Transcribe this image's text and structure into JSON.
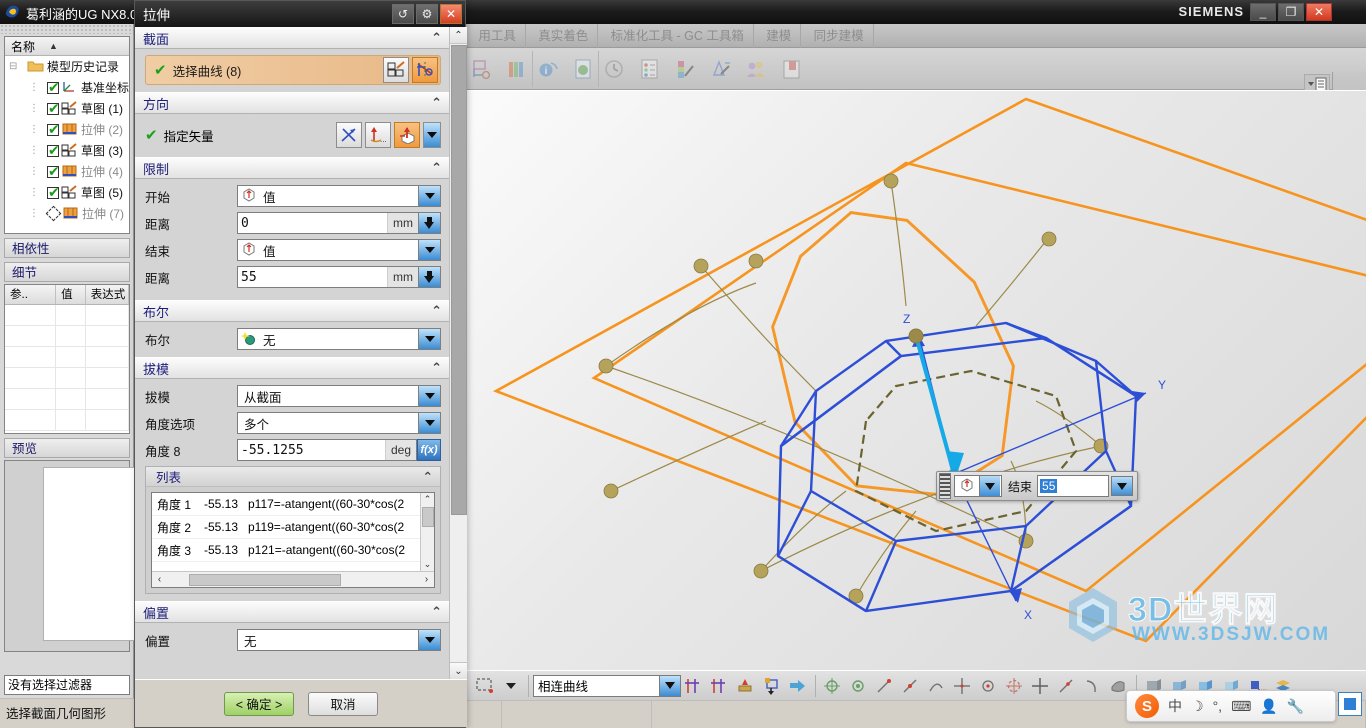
{
  "app": {
    "title": "葛利涵的UG NX8.0",
    "vendor": "SIEMENS",
    "window_buttons": {
      "minimize": "_",
      "maximize": "❐",
      "close": "✕"
    }
  },
  "ribbon": {
    "tabs": [
      {
        "label": "用工具"
      },
      {
        "label": "真实着色"
      },
      {
        "label": "标准化工具 - GC 工具箱"
      },
      {
        "label": "建模"
      },
      {
        "label": "同步建模"
      }
    ],
    "icons": [
      "datum-csys-icon",
      "library-icon",
      "information-icon",
      "report-icon",
      "history-icon",
      "list-icon",
      "gradient-pen-icon",
      "measure-pen-icon",
      "users-icon",
      "bookmark-icon"
    ],
    "panel_button_icon": "panel-list-icon"
  },
  "left_panel": {
    "tree": {
      "header": {
        "label": "名称",
        "sort_icon": "sort-asc-icon"
      },
      "root": {
        "label": "模型历史记录",
        "icon": "folder-icon",
        "expander": "collapse-icon"
      },
      "items": [
        {
          "checked": true,
          "icon": "datum-csys-icon",
          "label": "基准坐标",
          "dim": false
        },
        {
          "checked": true,
          "icon": "sketch-icon",
          "label": "草图 (1)",
          "dim": false
        },
        {
          "checked": true,
          "icon": "extrude-icon",
          "label": "拉伸 (2)",
          "dim": true
        },
        {
          "checked": true,
          "icon": "sketch-icon",
          "label": "草图 (3)",
          "dim": false
        },
        {
          "checked": true,
          "icon": "extrude-icon",
          "label": "拉伸 (4)",
          "dim": true
        },
        {
          "checked": true,
          "icon": "sketch-icon",
          "label": "草图 (5)",
          "dim": false
        },
        {
          "checked": false,
          "icon": "extrude-icon",
          "label": "拉伸 (7)",
          "dim": true
        }
      ]
    },
    "sections": {
      "dependency": "相依性",
      "detail": "细节",
      "preview": "预览"
    },
    "detail_columns": [
      "参..",
      "值",
      "表达式"
    ],
    "detail_sort_icon": "sort-asc-icon",
    "filter_value": "没有选择过滤器",
    "status_message": "选择截面几何图形"
  },
  "dialog": {
    "title": "拉伸",
    "title_buttons": [
      {
        "name": "reset-button",
        "glyph": "↺"
      },
      {
        "name": "settings-button",
        "glyph": "⚙"
      },
      {
        "name": "close-button",
        "glyph": "✕"
      }
    ],
    "groups": [
      {
        "name": "section",
        "header": "截面",
        "collapse_icon": "chevron-up-icon",
        "selection": {
          "check_icon": "green-check-icon",
          "label": "选择曲线 (8)",
          "buttons": [
            {
              "name": "select-curve-rule-button",
              "icon": "curve-rule-icon",
              "active": false
            },
            {
              "name": "sketch-section-button",
              "icon": "sketch-section-icon",
              "active": true
            }
          ]
        }
      },
      {
        "name": "direction",
        "header": "方向",
        "collapse_icon": "chevron-up-icon",
        "selection": {
          "check_icon": "green-check-icon",
          "label": "指定矢量",
          "buttons": [
            {
              "name": "vector-inferred-button",
              "icon": "vector-cross-icon",
              "active": false
            },
            {
              "name": "vector-dialog-button",
              "icon": "vector-dialog-icon",
              "active": false
            },
            {
              "name": "vector-direction-button",
              "icon": "vector-arrow-icon",
              "active": true
            }
          ],
          "dropdown_icon": "chevron-down-icon"
        }
      },
      {
        "name": "limits",
        "header": "限制",
        "collapse_icon": "chevron-up-icon",
        "fields": [
          {
            "label": "开始",
            "type": "combo",
            "icon": "value-cube-icon",
            "value": "值"
          },
          {
            "label": "距离",
            "type": "number",
            "value": "0",
            "unit": "mm"
          },
          {
            "label": "结束",
            "type": "combo",
            "icon": "value-cube-icon",
            "value": "值"
          },
          {
            "label": "距离",
            "type": "number",
            "value": "55",
            "unit": "mm"
          }
        ]
      },
      {
        "name": "boolean",
        "header": "布尔",
        "collapse_icon": "chevron-up-icon",
        "fields": [
          {
            "label": "布尔",
            "type": "combo",
            "icon": "boolean-none-icon",
            "value": "无"
          }
        ]
      },
      {
        "name": "draft",
        "header": "拔模",
        "collapse_icon": "chevron-up-icon",
        "fields": [
          {
            "label": "拔模",
            "type": "combo",
            "value": "从截面"
          },
          {
            "label": "角度选项",
            "type": "combo",
            "value": "多个"
          },
          {
            "label": "角度 8",
            "type": "expr",
            "value": "-55.1255",
            "unit": "deg",
            "fx": "f(x)"
          }
        ],
        "list": {
          "header": "列表",
          "collapse_icon": "chevron-up-icon",
          "rows": [
            {
              "name": "角度 1",
              "value": "-55.13",
              "expression": "p117=-atangent((60-30*cos(2"
            },
            {
              "name": "角度 2",
              "value": "-55.13",
              "expression": "p119=-atangent((60-30*cos(2"
            },
            {
              "name": "角度 3",
              "value": "-55.13",
              "expression": "p121=-atangent((60-30*cos(2"
            }
          ],
          "scroll": {
            "up": "⌃",
            "down": "⌄",
            "left": "‹",
            "right": "›"
          }
        }
      },
      {
        "name": "offset",
        "header": "偏置",
        "collapse_icon": "chevron-up-icon",
        "fields": [
          {
            "label": "偏置",
            "type": "combo",
            "value": "无"
          }
        ]
      }
    ],
    "scrollbar": {
      "up": "⌃",
      "down": "⌄"
    },
    "footer": {
      "ok": "< 确定 >",
      "cancel": "取消"
    }
  },
  "viewport": {
    "onscreen_input": {
      "combo_icon": "value-cube-icon",
      "label": "结束",
      "value": "55",
      "dropdown_icon": "chevron-down-icon",
      "spinner_icon": "spinner-down-icon",
      "grip_icon": "drag-grip-icon"
    },
    "axis_labels": {
      "x": "X",
      "y": "Y",
      "z": "Z"
    },
    "colors": {
      "section_orange": "#F7941E",
      "preview_blue": "#2D4FD6",
      "point_tan": "#B5A35C",
      "vector_cyan": "#15A9E8"
    },
    "watermark": {
      "text": "3D世界网",
      "url": "WWW.3DSJW.COM"
    }
  },
  "bottom_bar": {
    "filter_icon": "selection-rect-icon",
    "filter_dropdown_icon": "chevron-down-icon",
    "curve_rule": "相连曲线",
    "curve_rule_dropdown_icon": "chevron-down-icon",
    "icons": [
      "stop-at-intersection-icon",
      "follow-fillet-icon",
      "snap-point-icon",
      "face-edges-icon",
      "arrow-next-icon",
      "inferred-point-icon",
      "point-on-curve-icon",
      "endpoint-icon",
      "midpoint-icon",
      "arc-center-icon",
      "quadrant-icon",
      "existing-point-icon",
      "intersection-point-icon",
      "center-point-icon",
      "control-point-icon",
      "tangent-point-icon",
      "point-on-face-icon",
      "shaded-view-icon",
      "static-wireframe-icon",
      "top-view-icon",
      "trimetric-view-icon",
      "wcs-icon",
      "layer-icon"
    ]
  },
  "ime": {
    "logo": "S",
    "items": [
      "中",
      "☽",
      "°,",
      "⌨",
      "👤",
      "🔧"
    ],
    "restore_icon": "restore-icon"
  }
}
